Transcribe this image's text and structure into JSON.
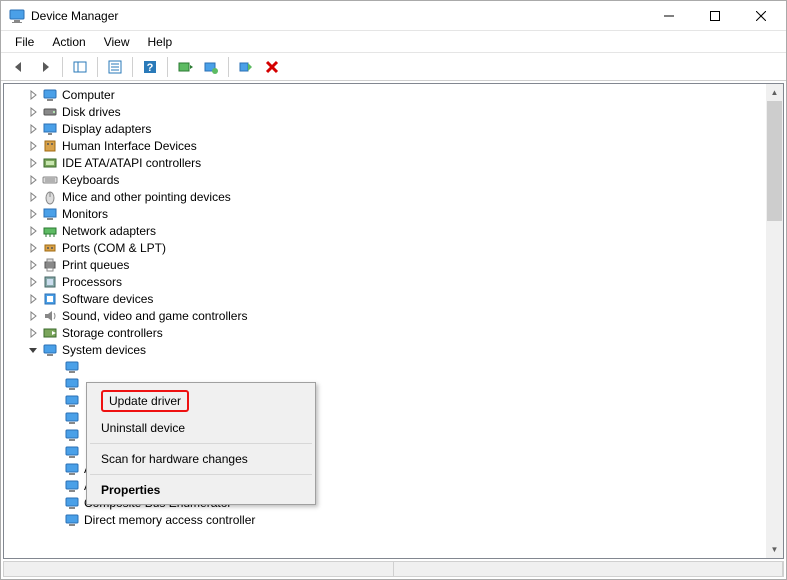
{
  "window": {
    "title": "Device Manager"
  },
  "menubar": {
    "file": "File",
    "action": "Action",
    "view": "View",
    "help": "Help"
  },
  "tree": {
    "categories": [
      {
        "label": "Computer",
        "icon": "computer"
      },
      {
        "label": "Disk drives",
        "icon": "disk"
      },
      {
        "label": "Display adapters",
        "icon": "display"
      },
      {
        "label": "Human Interface Devices",
        "icon": "hid"
      },
      {
        "label": "IDE ATA/ATAPI controllers",
        "icon": "ide"
      },
      {
        "label": "Keyboards",
        "icon": "keyboard"
      },
      {
        "label": "Mice and other pointing devices",
        "icon": "mouse"
      },
      {
        "label": "Monitors",
        "icon": "monitor"
      },
      {
        "label": "Network adapters",
        "icon": "network"
      },
      {
        "label": "Ports (COM & LPT)",
        "icon": "port"
      },
      {
        "label": "Print queues",
        "icon": "printer"
      },
      {
        "label": "Processors",
        "icon": "cpu"
      },
      {
        "label": "Software devices",
        "icon": "software"
      },
      {
        "label": "Sound, video and game controllers",
        "icon": "sound"
      },
      {
        "label": "Storage controllers",
        "icon": "storage"
      },
      {
        "label": "System devices",
        "icon": "system",
        "expanded": true
      }
    ],
    "system_children_visible": [
      {
        "label": "ACPI Thermal Zone"
      },
      {
        "label": "ACPI Thermal Zone"
      },
      {
        "label": "Composite Bus Enumerator"
      },
      {
        "label": "Direct memory access controller"
      }
    ]
  },
  "context_menu": {
    "update_driver": "Update driver",
    "uninstall_device": "Uninstall device",
    "scan_hardware": "Scan for hardware changes",
    "properties": "Properties"
  }
}
